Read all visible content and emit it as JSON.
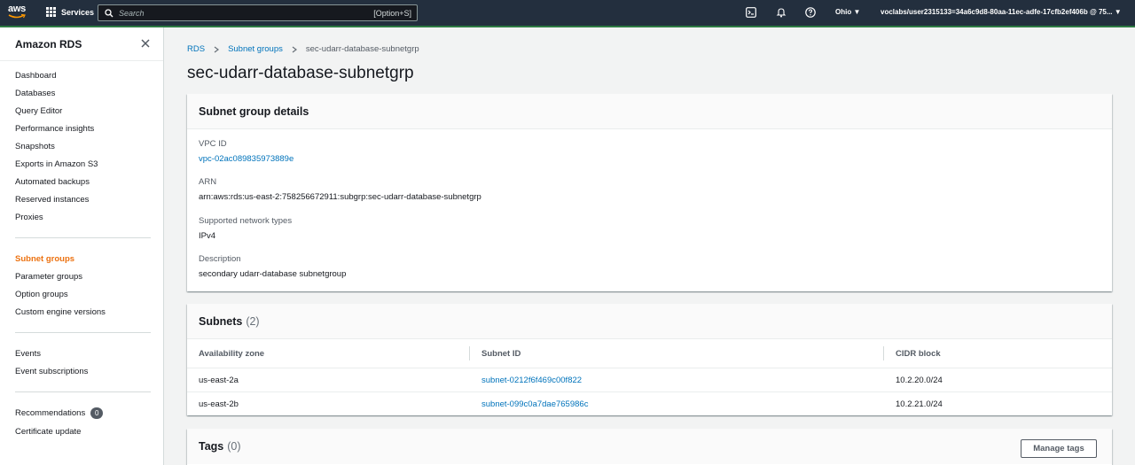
{
  "topnav": {
    "logo_text": "aws",
    "services_label": "Services",
    "search_placeholder": "Search",
    "search_shortcut": "[Option+S]",
    "region": "Ohio ▼",
    "account": "voclabs/user2315133=34a6c9d8-80aa-11ec-adfe-17cfb2ef406b @ 75... ▼"
  },
  "sidebar": {
    "title": "Amazon RDS",
    "groups": [
      [
        "Dashboard",
        "Databases",
        "Query Editor",
        "Performance insights",
        "Snapshots",
        "Exports in Amazon S3",
        "Automated backups",
        "Reserved instances",
        "Proxies"
      ],
      [
        "Subnet groups",
        "Parameter groups",
        "Option groups",
        "Custom engine versions"
      ],
      [
        "Events",
        "Event subscriptions"
      ],
      [
        "Recommendations",
        "Certificate update"
      ]
    ],
    "active_item": "Subnet groups",
    "recommendations_badge": "0"
  },
  "breadcrumb": {
    "items": [
      "RDS",
      "Subnet groups"
    ],
    "current": "sec-udarr-database-subnetgrp"
  },
  "page_title": "sec-udarr-database-subnetgrp",
  "details": {
    "title": "Subnet group details",
    "vpc_label": "VPC ID",
    "vpc_value": "vpc-02ac089835973889e",
    "arn_label": "ARN",
    "arn_value": "arn:aws:rds:us-east-2:758256672911:subgrp:sec-udarr-database-subnetgrp",
    "network_label": "Supported network types",
    "network_value": "IPv4",
    "description_label": "Description",
    "description_value": "secondary udarr-database subnetgroup"
  },
  "subnets": {
    "title": "Subnets",
    "count": "(2)",
    "columns": [
      "Availability zone",
      "Subnet ID",
      "CIDR block"
    ],
    "rows": [
      [
        "us-east-2a",
        "subnet-0212f6f469c00f822",
        "10.2.20.0/24"
      ],
      [
        "us-east-2b",
        "subnet-099c0a7dae765986c",
        "10.2.21.0/24"
      ]
    ]
  },
  "tags": {
    "title": "Tags",
    "count": "(0)",
    "manage_button": "Manage tags"
  },
  "colors": {
    "nav_bg": "#232f3e",
    "accent_active": "#ec7211",
    "link": "#0073bb"
  }
}
